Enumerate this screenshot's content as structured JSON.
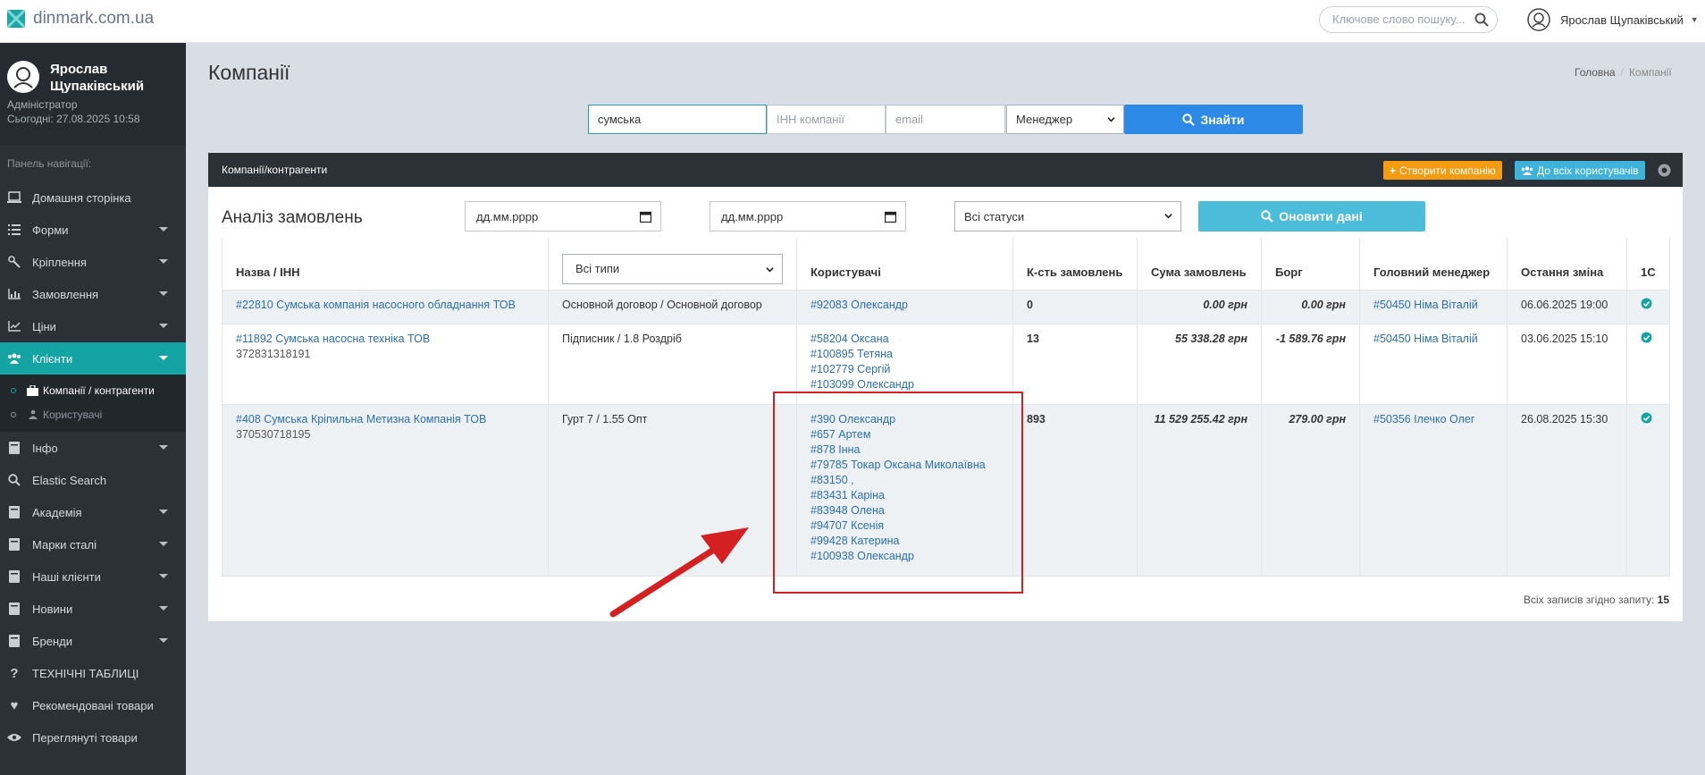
{
  "topbar": {
    "site": "dinmark.com.ua",
    "search_placeholder": "Ключове слово пошуку...",
    "user_name": "Ярослав Щупаківський"
  },
  "sidebar": {
    "profile_name": "Ярослав Щупаківський",
    "role": "Адміністратор",
    "today": "Сьогодні: 27.08.2025 10:58",
    "caption": "Панель навігації:",
    "items": [
      {
        "label": "Домашня сторінка",
        "icon": "laptop-icon"
      },
      {
        "label": "Форми",
        "icon": "list-icon"
      },
      {
        "label": "Кріплення",
        "icon": "wrench-icon"
      },
      {
        "label": "Замовлення",
        "icon": "bar-chart-icon"
      },
      {
        "label": "Ціни",
        "icon": "line-chart-icon"
      },
      {
        "label": "Клієнти",
        "icon": "users-icon"
      },
      {
        "label": "Інфо",
        "icon": "book-icon"
      },
      {
        "label": "Elastic Search",
        "icon": "search-icon"
      },
      {
        "label": "Академія",
        "icon": "book-icon"
      },
      {
        "label": "Марки сталі",
        "icon": "book-icon"
      },
      {
        "label": "Наші клієнти",
        "icon": "book-icon"
      },
      {
        "label": "Новини",
        "icon": "book-icon"
      },
      {
        "label": "Бренди",
        "icon": "book-icon"
      },
      {
        "label": "ТЕХНІЧНІ ТАБЛИЦІ",
        "icon": "question-icon"
      },
      {
        "label": "Рекомендовані товари",
        "icon": "heart-icon"
      },
      {
        "label": "Переглянуті товари",
        "icon": "eye-icon"
      }
    ],
    "sub_items": [
      {
        "label": "Компанії / контрагенти"
      },
      {
        "label": "Користувачі"
      }
    ]
  },
  "page": {
    "title": "Компанії",
    "breadcrumb_home": "Головна",
    "breadcrumb_current": "Компанії"
  },
  "filters": {
    "name_value": "сумська",
    "inn_placeholder": "ІНН компанії",
    "email_placeholder": "email",
    "manager_selected": "Менеджер",
    "find_label": "Знайти"
  },
  "panel": {
    "title": "Компанії/контрагенти",
    "create_label": "Створити компанію",
    "users_label": "До всіх користувачів",
    "analysis_title": "Аналіз замовлень",
    "date_from": "дд.мм.рррр",
    "date_to": "дд.мм.рррр",
    "status_selected": "Всі статуси",
    "refresh_label": "Оновити дані",
    "total_label": "Всіх записів згідно запиту:",
    "total_value": "15"
  },
  "table": {
    "headers": {
      "name": "Назва / ІНН",
      "type_selected": "Всі типи",
      "users": "Користувачі",
      "count": "К-сть замовлень",
      "sum": "Сума замовлень",
      "debt": "Борг",
      "manager": "Головний менеджер",
      "changed": "Остання зміна",
      "c1": "1С"
    },
    "rows": [
      {
        "name": "#22810 Сумська компанія насосного обладнання ТОВ",
        "inn": "",
        "type": "Основной договор / Основной договор",
        "users": [
          "#92083 Олександр"
        ],
        "count": "0",
        "sum": "0.00 грн",
        "debt": "0.00 грн",
        "manager": "#50450 Німа Віталій",
        "changed": "06.06.2025 19:00"
      },
      {
        "name": "#11892 Сумська насосна техніка ТОВ",
        "inn": "372831318191",
        "type": "Підписник / 1.8 Роздріб",
        "users": [
          "#58204 Оксана",
          "#100895 Тетяна",
          "#102779 Сергій",
          "#103099 Олександр"
        ],
        "count": "13",
        "sum": "55 338.28 грн",
        "debt": "-1 589.76 грн",
        "manager": "#50450 Німа Віталій",
        "changed": "03.06.2025 15:10"
      },
      {
        "name": "#408 Сумська Кріпильна Метизна Компанія ТОВ",
        "inn": "370530718195",
        "type": "Гурт 7 / 1.55 Опт",
        "users": [
          "#390 Олександр",
          "#657 Артем",
          "#878 Інна",
          "#79785 Токар Оксана Миколаївна",
          "#83150 ,",
          "#83431 Каріна",
          "#83948 Олена",
          "#94707 Ксенія",
          "#99428 Катерина",
          "#100938 Олександр"
        ],
        "count": "893",
        "sum": "11 529 255.42 грн",
        "debt": "279.00 грн",
        "manager": "#50356 Ілечко Олег",
        "changed": "26.08.2025 15:30"
      }
    ]
  },
  "colors": {
    "accent": "#14a4a4",
    "find_button": "#2d8ae6",
    "refresh_button": "#4bbcd9",
    "create_button": "#f39c12",
    "annotation": "#d42020"
  }
}
